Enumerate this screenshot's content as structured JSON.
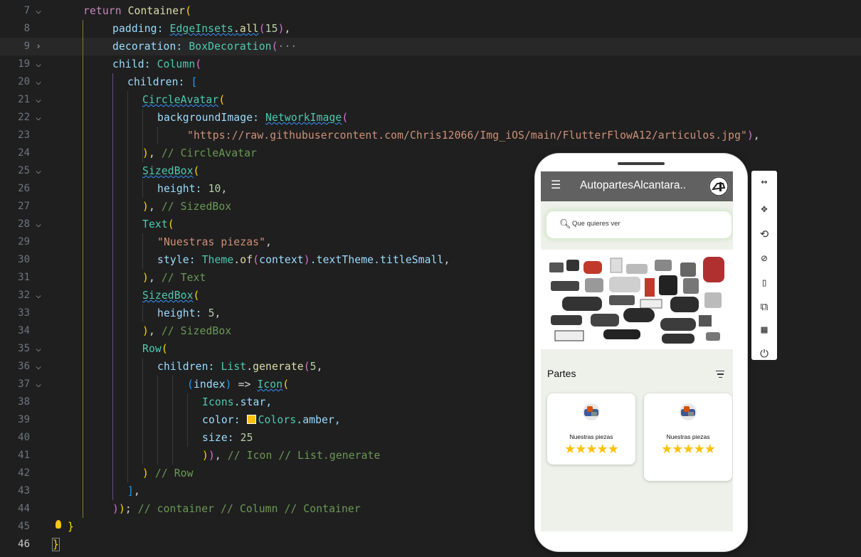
{
  "editor": {
    "lines": [
      {
        "n": "7",
        "fold": "down"
      },
      {
        "n": "8"
      },
      {
        "n": "9",
        "fold": "right"
      },
      {
        "n": "19",
        "fold": "down"
      },
      {
        "n": "20",
        "fold": "down"
      },
      {
        "n": "21",
        "fold": "down"
      },
      {
        "n": "22",
        "fold": "down"
      },
      {
        "n": "23"
      },
      {
        "n": "24"
      },
      {
        "n": "25",
        "fold": "down"
      },
      {
        "n": "26"
      },
      {
        "n": "27"
      },
      {
        "n": "28",
        "fold": "down"
      },
      {
        "n": "29"
      },
      {
        "n": "30"
      },
      {
        "n": "31"
      },
      {
        "n": "32",
        "fold": "down"
      },
      {
        "n": "33"
      },
      {
        "n": "34"
      },
      {
        "n": "35",
        "fold": "down"
      },
      {
        "n": "36",
        "fold": "down"
      },
      {
        "n": "37",
        "fold": "down"
      },
      {
        "n": "38"
      },
      {
        "n": "39"
      },
      {
        "n": "40"
      },
      {
        "n": "41"
      },
      {
        "n": "42"
      },
      {
        "n": "43"
      },
      {
        "n": "44"
      },
      {
        "n": "45"
      },
      {
        "n": "46"
      }
    ],
    "code": {
      "l7_kw": "return",
      "l7_fn": "Container",
      "l8_prop": "padding:",
      "l8_ty": "EdgeInsets",
      "l8_fn": "all",
      "l8_num": "15",
      "l9_prop": "decoration:",
      "l9_ty": "BoxDecoration",
      "l9_fold": "···",
      "l19_prop": "child:",
      "l19_ty": "Column",
      "l20_prop": "children:",
      "l21_ty": "CircleAvatar",
      "l22_prop": "backgroundImage:",
      "l22_ty": "NetworkImage",
      "l23_str": "\"https://raw.githubusercontent.com/Chris12066/Img_iOS/main/FlutterFlowA12/articulos.jpg\"",
      "l24_cm": "// CircleAvatar",
      "l25_ty": "SizedBox",
      "l26_prop": "height:",
      "l26_num": "10",
      "l27_cm": "// SizedBox",
      "l28_ty": "Text",
      "l29_str": "\"Nuestras piezas\"",
      "l30_prop": "style:",
      "l30_ty": "Theme",
      "l30_fn": "of",
      "l30_arg": "context",
      "l30_chain": ".textTheme.titleSmall",
      "l31_cm": "// Text",
      "l32_ty": "SizedBox",
      "l33_prop": "height:",
      "l33_num": "5",
      "l34_cm": "// SizedBox",
      "l35_ty": "Row",
      "l36_prop": "children:",
      "l36_ty": "List",
      "l36_fn": "generate",
      "l36_num": "5",
      "l37_arg": "index",
      "l37_arrow": "=>",
      "l37_ty": "Icon",
      "l38_ty": "Icons",
      "l38_val": ".star,",
      "l39_prop": "color:",
      "l39_ty": "Colors",
      "l39_val": ".amber,",
      "l40_prop": "size:",
      "l40_num": "25",
      "l41_cm": "// Icon // List.generate",
      "l42_cm": "// Row",
      "l44_cm": "// container // Column // Container"
    }
  },
  "phone": {
    "app_title": "AutopartesAlcantara..",
    "menu_icon": "hamburger-menu-icon",
    "search_placeholder": "Que quieres ver",
    "section_title": "Partes",
    "cards": [
      {
        "title": "Nuestras piezas",
        "rating": 5,
        "stars": "★★★★★"
      },
      {
        "title": "Nuestras piezas",
        "rating": 5,
        "stars": "★★★★★"
      }
    ],
    "colors": {
      "appbar": "#616161",
      "star": "#ffc107",
      "search_glow": "#d6e8cf",
      "screen_bg": "#eef0ea"
    }
  },
  "toolbar": {
    "items": [
      {
        "icon": "resize-arrows-icon",
        "glyph": "↔"
      },
      {
        "icon": "move-icon",
        "glyph": "✥"
      },
      {
        "icon": "rotate-icon",
        "glyph": "⟲"
      },
      {
        "icon": "rotate-device-icon",
        "glyph": "⊘"
      },
      {
        "icon": "device-frame-icon",
        "glyph": "▯"
      },
      {
        "icon": "external-link-icon",
        "glyph": "⧉"
      },
      {
        "icon": "qr-code-icon",
        "glyph": "▦"
      },
      {
        "icon": "power-icon",
        "glyph": "⏻"
      }
    ]
  }
}
